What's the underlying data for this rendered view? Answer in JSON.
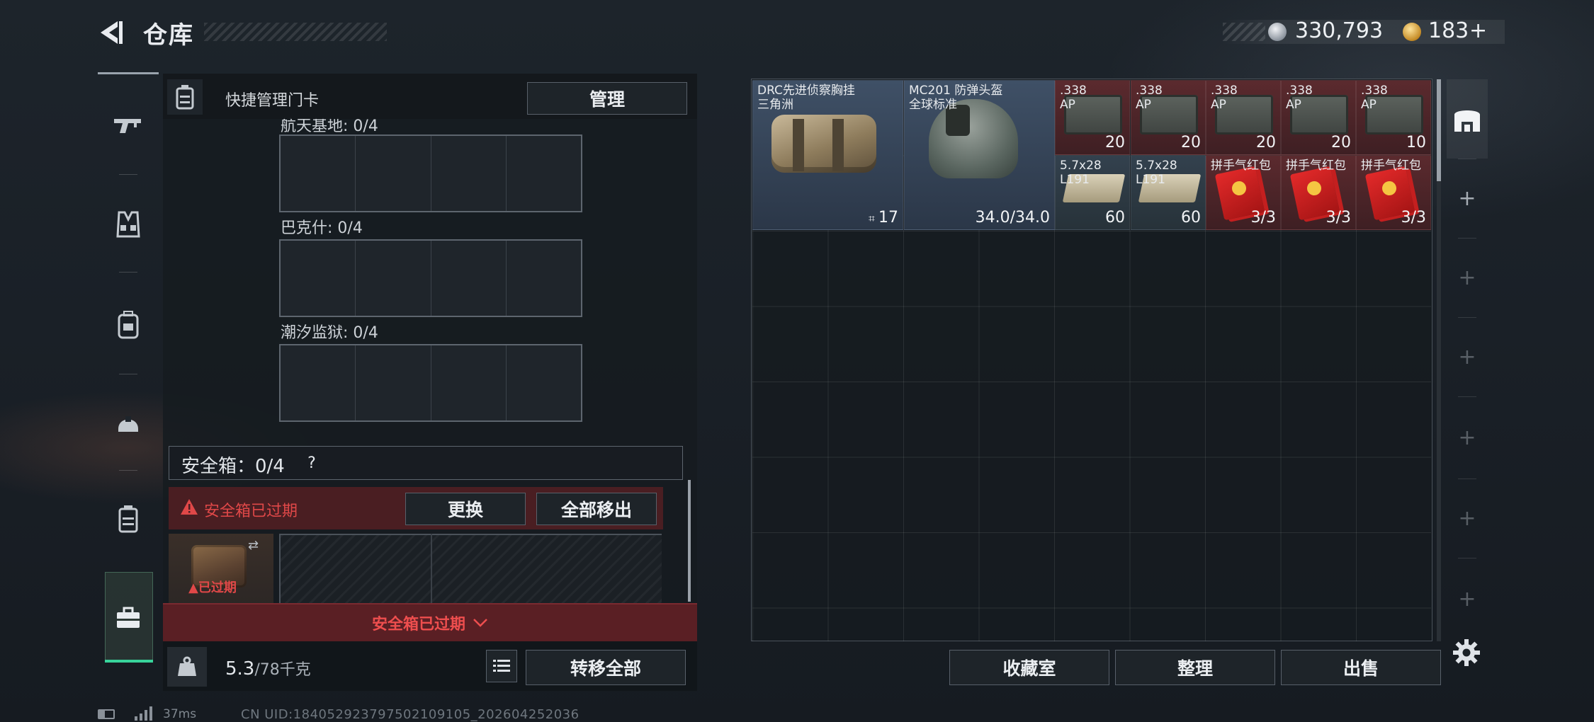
{
  "header": {
    "title": "仓库",
    "silver_amount": "330,793",
    "gold_amount": "183",
    "gold_plus": "+"
  },
  "left_nav": {
    "items": [
      "weapon-icon",
      "vest-icon",
      "backpack-icon",
      "helmet-icon",
      "case-icon",
      "toolbox-icon"
    ],
    "active_index": 5,
    "accent_color": "#38d49b"
  },
  "keycard": {
    "label": "快捷管理门卡",
    "manage_button": "管理",
    "maps": [
      {
        "label": "航天基地: 0/4"
      },
      {
        "label": "巴克什: 0/4"
      },
      {
        "label": "潮汐监狱: 0/4"
      }
    ]
  },
  "safe_box": {
    "title": "安全箱：0/4",
    "help": "?",
    "expired_notice": "安全箱已过期",
    "replace_button": "更换",
    "move_all_button": "全部移出",
    "case_expired_tag": "已过期",
    "banner_text": "安全箱已过期",
    "alert_color": "#e04848"
  },
  "footer_left": {
    "weight_value": "5.3",
    "weight_max": "/78千克",
    "transfer_all_button": "转移全部"
  },
  "stash": {
    "items": [
      {
        "name_line1": "DRC先进侦察胸挂",
        "name_line2": "三角洲",
        "count": "17",
        "rarity": "blue",
        "icon": "chest-rig"
      },
      {
        "name_line1": "MC201 防弹头盔",
        "name_line2": "全球标准",
        "count": "34.0/34.0",
        "rarity": "blue",
        "icon": "helmet"
      },
      {
        "name_line1": ".338",
        "name_line2": "AP",
        "count": "20",
        "rarity": "red",
        "icon": "ammo-box"
      },
      {
        "name_line1": ".338",
        "name_line2": "AP",
        "count": "20",
        "rarity": "red",
        "icon": "ammo-box"
      },
      {
        "name_line1": ".338",
        "name_line2": "AP",
        "count": "20",
        "rarity": "red",
        "icon": "ammo-box"
      },
      {
        "name_line1": ".338",
        "name_line2": "AP",
        "count": "20",
        "rarity": "red",
        "icon": "ammo-box"
      },
      {
        "name_line1": ".338",
        "name_line2": "AP",
        "count": "10",
        "rarity": "red",
        "icon": "ammo-box"
      },
      {
        "name_line1": "5.7x28",
        "name_line2": "L191",
        "count": "60",
        "rarity": "steel",
        "icon": "ammo-57"
      },
      {
        "name_line1": "5.7x28",
        "name_line2": "L191",
        "count": "60",
        "rarity": "steel",
        "icon": "ammo-57"
      },
      {
        "name_line1": "拼手气红包",
        "name_line2": "",
        "count": "3/3",
        "rarity": "red",
        "icon": "red-envelope"
      },
      {
        "name_line1": "拼手气红包",
        "name_line2": "",
        "count": "3/3",
        "rarity": "red",
        "icon": "red-envelope"
      },
      {
        "name_line1": "拼手气红包",
        "name_line2": "",
        "count": "3/3",
        "rarity": "red",
        "icon": "red-envelope"
      }
    ],
    "buttons": {
      "collection": "收藏室",
      "organize": "整理",
      "sell": "出售"
    },
    "rail_plus": "+"
  },
  "status_bar": {
    "ping": "37ms",
    "uid": "CN UID:1840529237975021091​05_202604252036"
  }
}
